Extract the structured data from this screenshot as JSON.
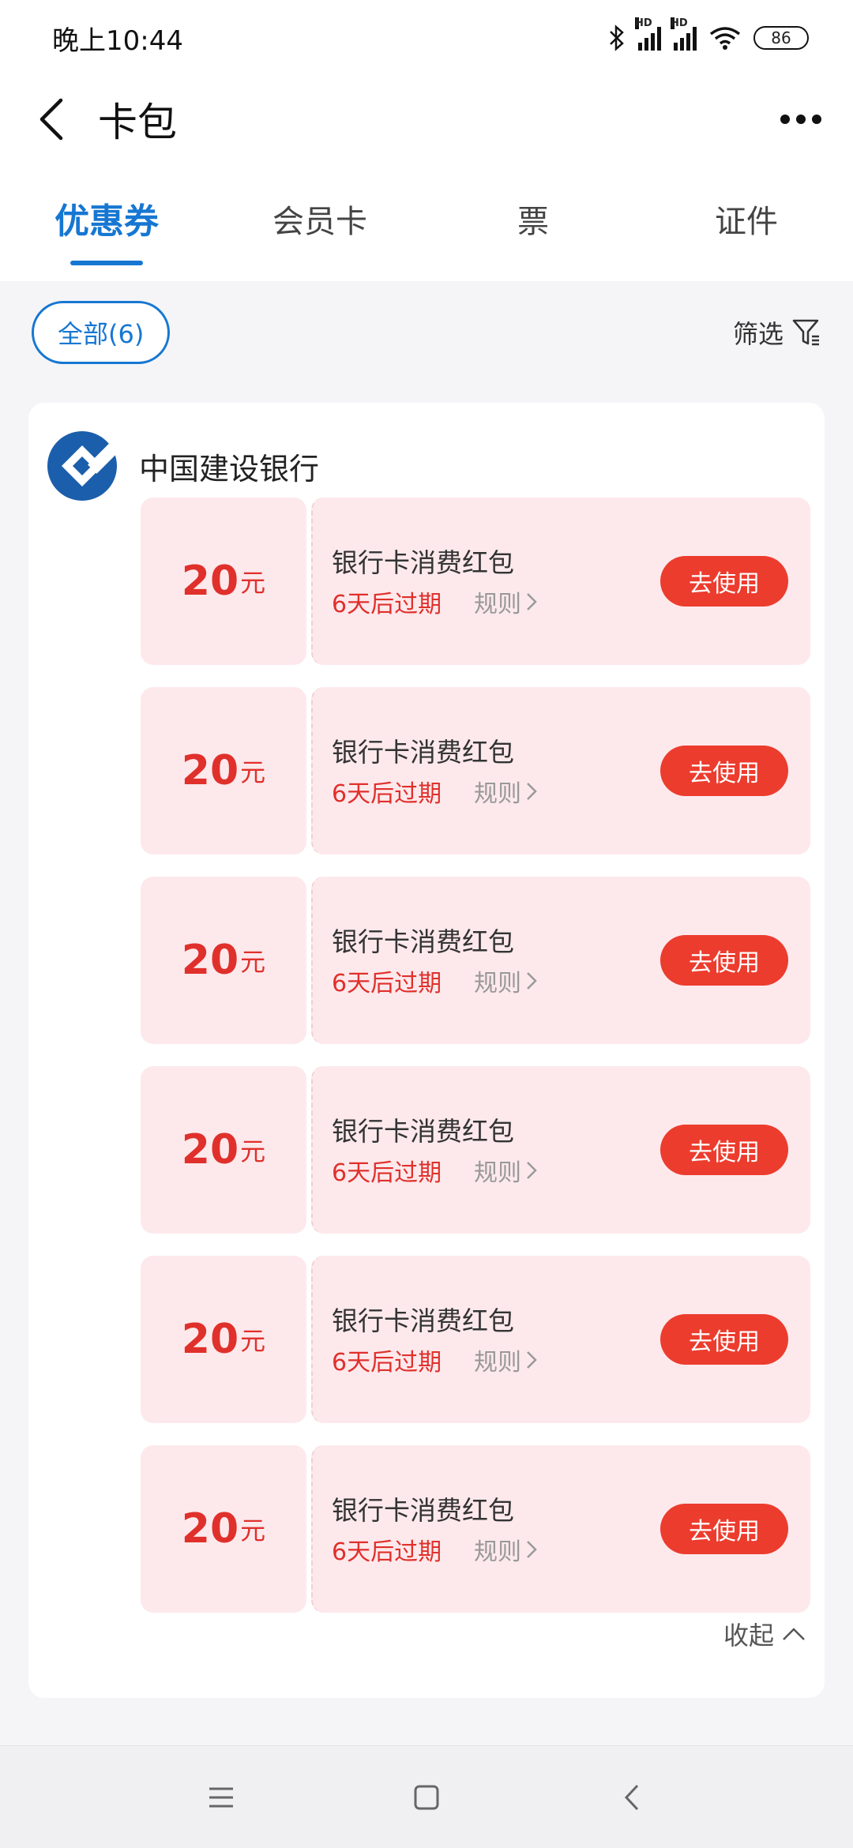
{
  "status_bar": {
    "time": "晚上10:44",
    "signal_label_1": "HD",
    "signal_label_2": "HD",
    "battery": "86"
  },
  "header": {
    "title": "卡包",
    "back_icon": "back-icon",
    "more_icon": "more-icon"
  },
  "tabs": [
    {
      "label": "优惠券",
      "active": true
    },
    {
      "label": "会员卡",
      "active": false
    },
    {
      "label": "票",
      "active": false
    },
    {
      "label": "证件",
      "active": false
    }
  ],
  "filter": {
    "all_label": "全部(6)",
    "filter_label": "筛选"
  },
  "group": {
    "bank_name": "中国建设银行",
    "collapse_label": "收起"
  },
  "coupons": [
    {
      "amount": "20",
      "unit": "元",
      "title": "银行卡消费红包",
      "expire": "6天后过期",
      "rule": "规则",
      "button": "去使用"
    },
    {
      "amount": "20",
      "unit": "元",
      "title": "银行卡消费红包",
      "expire": "6天后过期",
      "rule": "规则",
      "button": "去使用"
    },
    {
      "amount": "20",
      "unit": "元",
      "title": "银行卡消费红包",
      "expire": "6天后过期",
      "rule": "规则",
      "button": "去使用"
    },
    {
      "amount": "20",
      "unit": "元",
      "title": "银行卡消费红包",
      "expire": "6天后过期",
      "rule": "规则",
      "button": "去使用"
    },
    {
      "amount": "20",
      "unit": "元",
      "title": "银行卡消费红包",
      "expire": "6天后过期",
      "rule": "规则",
      "button": "去使用"
    },
    {
      "amount": "20",
      "unit": "元",
      "title": "银行卡消费红包",
      "expire": "6天后过期",
      "rule": "规则",
      "button": "去使用"
    }
  ],
  "colors": {
    "accent": "#1677d2",
    "coupon_bg": "#fde9ec",
    "coupon_red": "#e0302b",
    "button_red": "#ec3c2e",
    "bank_logo": "#1b5eab"
  }
}
